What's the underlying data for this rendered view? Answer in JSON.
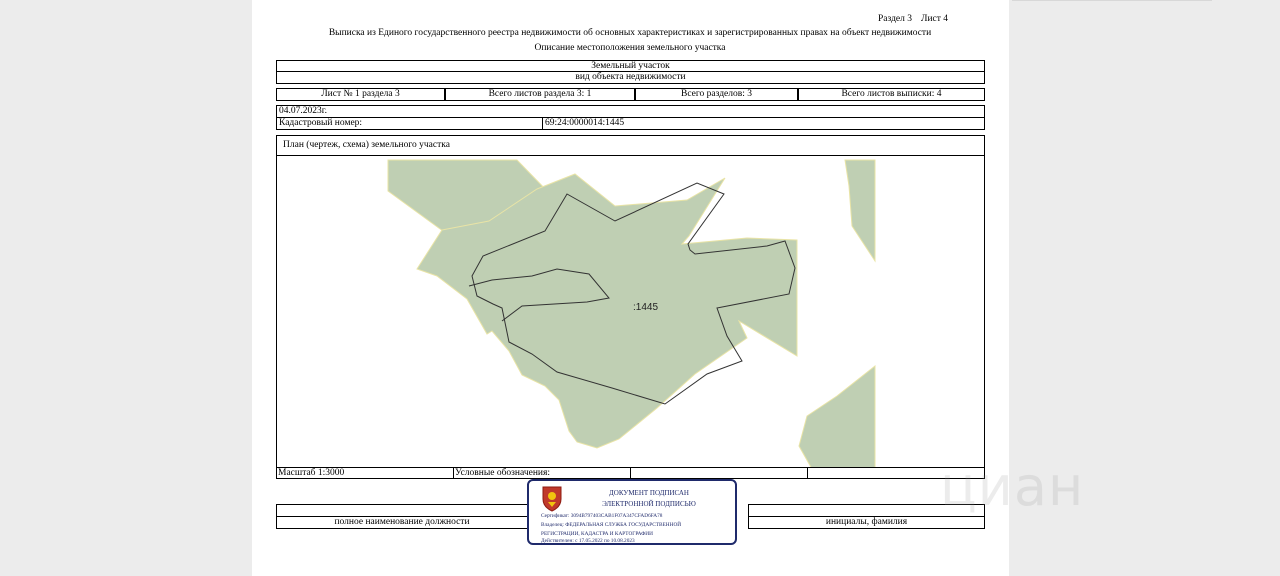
{
  "header": {
    "section_label": "Раздел 3",
    "sheet_label": "Лист 4",
    "title": "Выписка из Единого государственного реестра недвижимости об основных характеристиках и зарегистрированных правах на объект недвижимости",
    "subtitle": "Описание местоположения земельного участка"
  },
  "object": {
    "type": "Земельный участок",
    "type_caption": "вид объекта недвижимости"
  },
  "sheets_row": {
    "sheet_no": "Лист № 1 раздела 3",
    "total_sheets_section": "Всего листов раздела 3: 1",
    "total_sections": "Всего разделов: 3",
    "total_sheets": "Всего листов выписки: 4"
  },
  "date": "04.07.2023г.",
  "cadastral": {
    "label": "Кадастровый номер:",
    "value": "69:24:0000014:1445"
  },
  "plan": {
    "title": "План (чертеж, схема) земельного участка",
    "parcel_label": ":1445",
    "fill_color": "#bfcfb3",
    "edge_color": "#e9e4a6",
    "outline_color": "#333333"
  },
  "footer": {
    "scale": "Масштаб 1:3000",
    "legend": "Условные обозначения:",
    "position_caption": "полное наименование должности",
    "initials_caption": "инициалы, фамилия"
  },
  "stamp": {
    "line1": "ДОКУМЕНТ ПОДПИСАН",
    "line2": "ЭЛЕКТРОННОЙ ПОДПИСЬЮ",
    "certificate": "Сертификат: 3094B797403CAB1F07A347CFAD6FA78",
    "owner1": "Владелец: ФЕДЕРАЛЬНАЯ СЛУЖБА ГОСУДАРСТВЕННОЙ",
    "owner2": "РЕГИСТРАЦИИ, КАДАСТРА И КАРТОГРАФИИ",
    "valid": "Действителен: с 17.05.2022 по 10.08.2023",
    "emblem_icon": "emblem-icon",
    "color": "#1f2a6b"
  },
  "watermark": "циан"
}
